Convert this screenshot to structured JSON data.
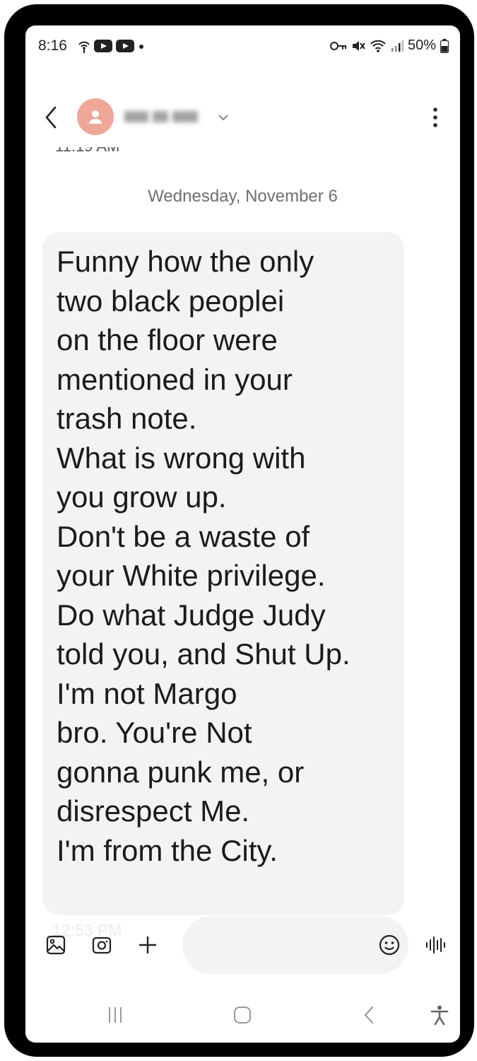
{
  "status_bar": {
    "time": "8:16",
    "battery": "50%",
    "icons": [
      "hotspot-icon",
      "youtube-icon",
      "youtube-icon",
      "dot-icon",
      "vpn-key-icon",
      "mute-icon",
      "wifi-icon",
      "signal-icon",
      "battery-icon"
    ]
  },
  "header": {
    "contact_name": "",
    "avatar_icon": "person-icon",
    "icons": [
      "back-icon",
      "chevron-down-icon",
      "more-vert-icon"
    ]
  },
  "conversation": {
    "clipped_time": "11:19 AM",
    "date_separator": "Wednesday, November 6",
    "message": "Funny how the only\ntwo black peoplei\non the floor were\nmentioned in your\ntrash note.\nWhat is wrong with\nyou grow up.\nDon't be a waste of\nyour White privilege.\nDo what Judge Judy\ntold you, and  Shut Up.\nI'm not Margo\nbro. You're Not\ngonna punk me, or\ndisrespect Me.\nI'm from the City.",
    "faded_time": "12:53 PM"
  },
  "composer": {
    "placeholder": "",
    "icons": [
      "gallery-icon",
      "camera-icon",
      "add-icon",
      "emoji-icon",
      "voice-icon"
    ]
  },
  "navbar": {
    "icons": [
      "recents-icon",
      "home-icon",
      "back-nav-icon",
      "accessibility-icon"
    ]
  },
  "colors": {
    "avatar": "#efa898",
    "bubble": "#f3f3f5",
    "date_text": "#6f6f6f",
    "message_text": "#1b1b1b"
  }
}
